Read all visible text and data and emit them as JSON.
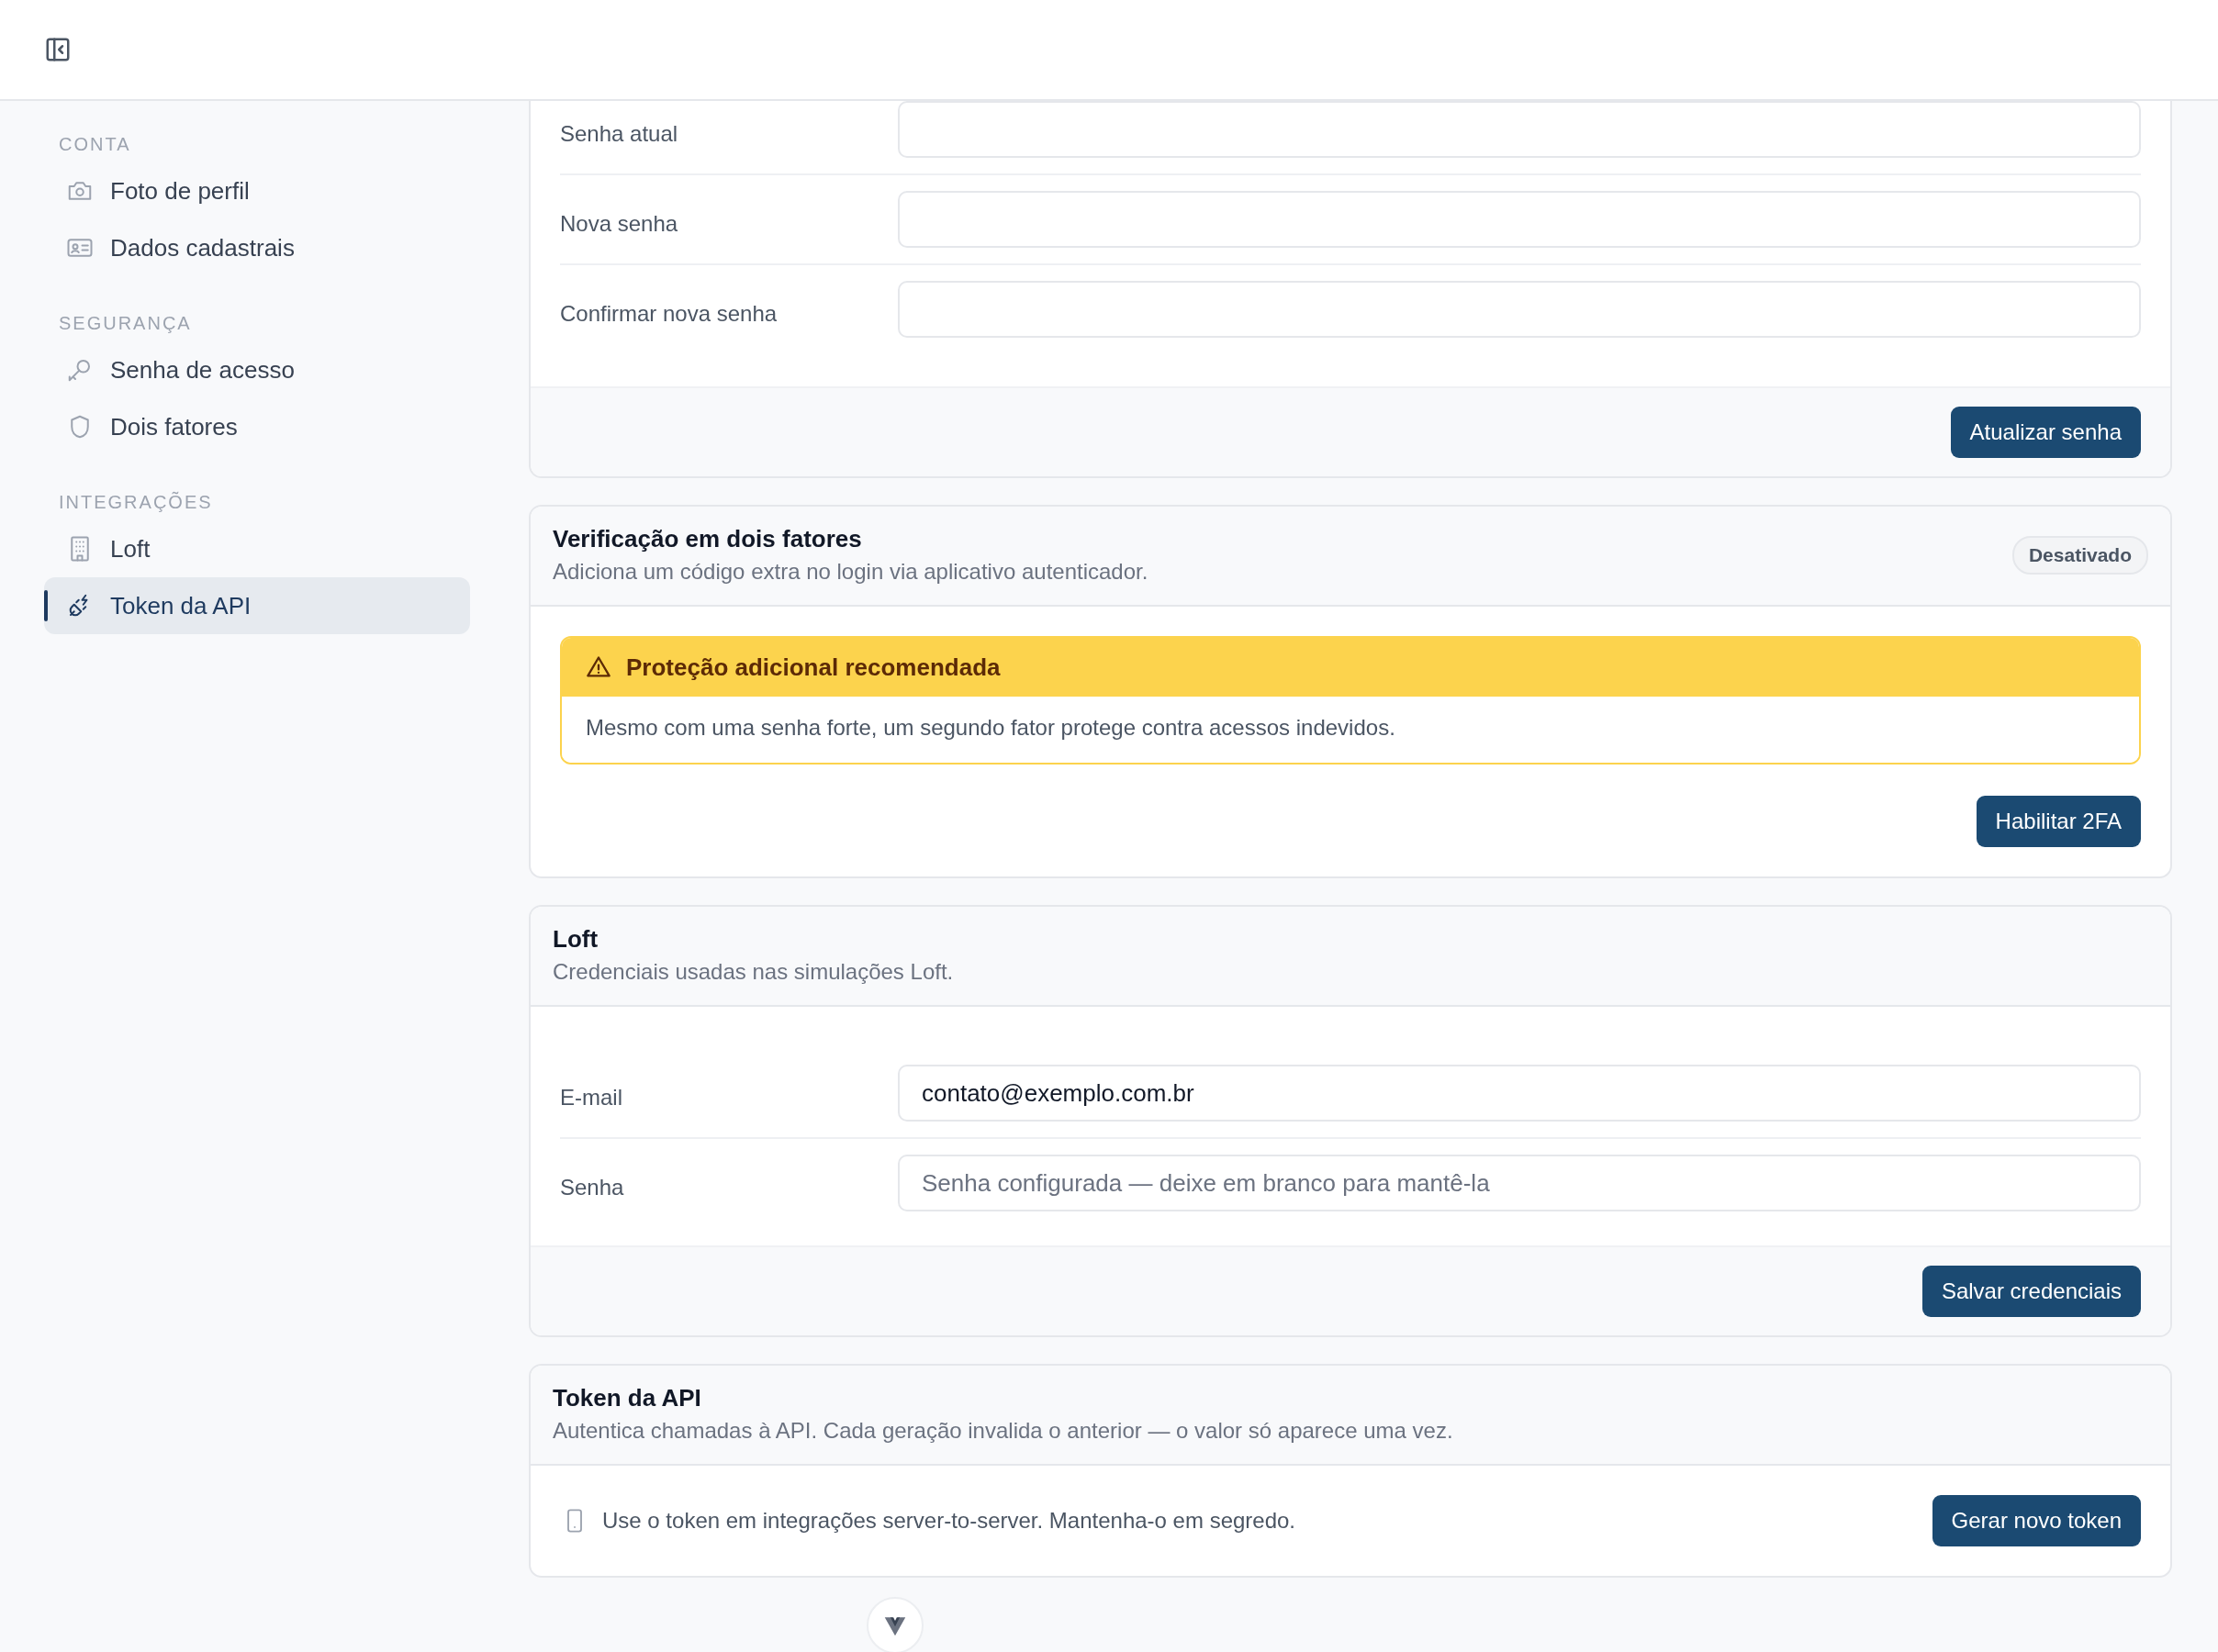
{
  "sidebar": {
    "sections": [
      {
        "title": "CONTA",
        "items": [
          {
            "label": "Foto de perfil",
            "selected": false
          },
          {
            "label": "Dados cadastrais",
            "selected": false
          }
        ]
      },
      {
        "title": "SEGURANÇA",
        "items": [
          {
            "label": "Senha de acesso",
            "selected": false
          },
          {
            "label": "Dois fatores",
            "selected": false
          }
        ]
      },
      {
        "title": "INTEGRAÇÕES",
        "items": [
          {
            "label": "Loft",
            "selected": false
          },
          {
            "label": "Token da API",
            "selected": true
          }
        ]
      }
    ]
  },
  "password_card": {
    "fields": [
      {
        "label": "Senha atual"
      },
      {
        "label": "Nova senha"
      },
      {
        "label": "Confirmar nova senha"
      }
    ],
    "button": "Atualizar senha"
  },
  "two_factor_card": {
    "title": "Verificação em dois fatores",
    "subtitle": "Adiciona um código extra no login via aplicativo autenticador.",
    "status": "Desativado",
    "alert": {
      "title": "Proteção adicional recomendada",
      "body": "Mesmo com uma senha forte, um segundo fator protege contra acessos indevidos."
    },
    "button": "Habilitar 2FA"
  },
  "loft_card": {
    "title": "Loft",
    "subtitle": "Credenciais usadas nas simulações Loft.",
    "fields": [
      {
        "label": "E-mail",
        "value": "contato@exemplo.com.br"
      },
      {
        "label": "Senha",
        "placeholder": "Senha configurada — deixe em branco para mantê-la"
      }
    ],
    "button": "Salvar credenciais"
  },
  "api_token_card": {
    "title": "Token da API",
    "subtitle": "Autentica chamadas à API. Cada geração invalida o anterior — o valor só aparece uma vez.",
    "note": "Use o token em integrações server-to-server. Mantenha-o em segredo.",
    "button": "Gerar novo token"
  }
}
